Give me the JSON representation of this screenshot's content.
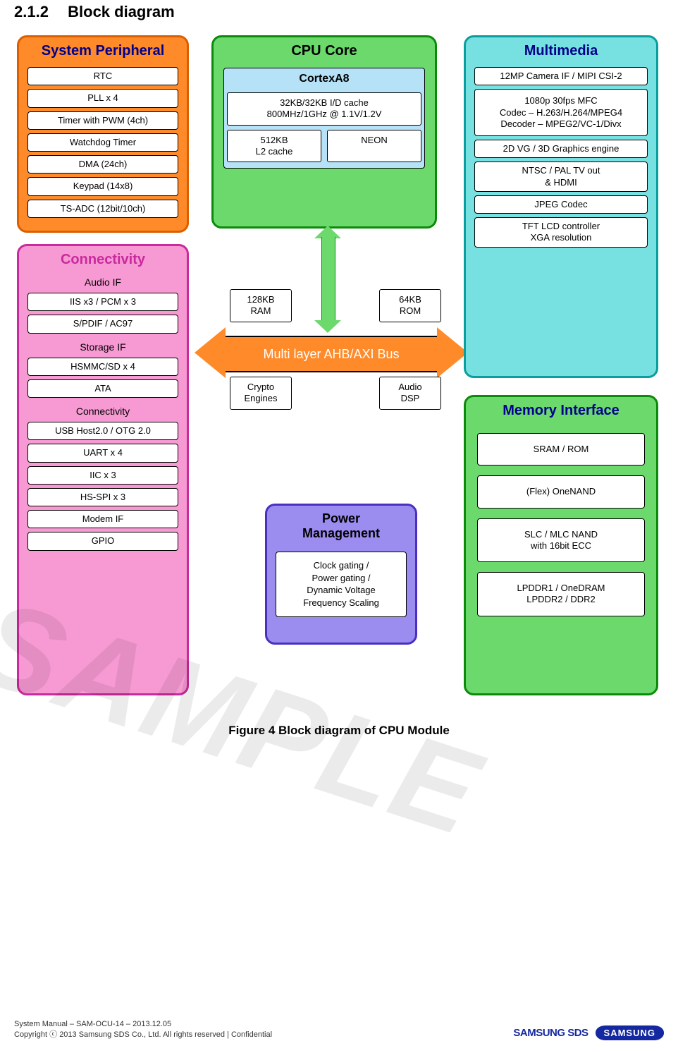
{
  "heading": {
    "number": "2.1.2",
    "title": "Block diagram"
  },
  "cpu": {
    "title": "CPU Core",
    "cortex_title": "CortexA8",
    "cache_line": "32KB/32KB I/D cache\n800MHz/1GHz @ 1.1V/1.2V",
    "l2": "512KB\nL2 cache",
    "neon": "NEON"
  },
  "sysperiph": {
    "title": "System Peripheral",
    "items": [
      "RTC",
      "PLL x 4",
      "Timer with PWM (4ch)",
      "Watchdog Timer",
      "DMA (24ch)",
      "Keypad (14x8)",
      "TS-ADC (12bit/10ch)"
    ]
  },
  "connectivity": {
    "title": "Connectivity",
    "sec1": {
      "title": "Audio IF",
      "items": [
        "IIS x3 / PCM x 3",
        "S/PDIF / AC97"
      ]
    },
    "sec2": {
      "title": "Storage IF",
      "items": [
        "HSMMC/SD x 4",
        "ATA"
      ]
    },
    "sec3": {
      "title": "Connectivity",
      "items": [
        "USB Host2.0 / OTG 2.0",
        "UART x 4",
        "IIC x 3",
        "HS-SPI x 3",
        "Modem IF",
        "GPIO"
      ]
    }
  },
  "multimedia": {
    "title": "Multimedia",
    "items": [
      "12MP Camera IF / MIPI CSI-2",
      "1080p 30fps MFC\nCodec – H.263/H.264/MPEG4\nDecoder – MPEG2/VC-1/Divx",
      "2D VG / 3D Graphics engine",
      "NTSC / PAL TV out\n& HDMI",
      "JPEG Codec",
      "TFT LCD controller\nXGA resolution"
    ]
  },
  "memif": {
    "title": "Memory Interface",
    "items": [
      "SRAM / ROM",
      "(Flex) OneNAND",
      "SLC / MLC NAND\nwith 16bit ECC",
      "LPDDR1 / OneDRAM\nLPDDR2 / DDR2"
    ]
  },
  "power": {
    "title": "Power\nManagement",
    "body": "Clock gating /\nPower gating /\nDynamic Voltage\nFrequency Scaling"
  },
  "bus": {
    "label": "Multi layer AHB/AXI Bus",
    "ram": "128KB\nRAM",
    "rom": "64KB\nROM",
    "crypto": "Crypto\nEngines",
    "adsp": "Audio\nDSP"
  },
  "figure_caption": "Figure  4  Block diagram  of  CPU Module",
  "watermark": "SAMPLE",
  "footer": {
    "line1": "System Manual – SAM-OCU-14 – 2013.12.05",
    "line2": "Copyright ⓒ 2013 Samsung SDS Co., Ltd. All rights reserved   |   Confidential",
    "logo1": "SAMSUNG SDS",
    "logo2": "SAMSUNG"
  }
}
